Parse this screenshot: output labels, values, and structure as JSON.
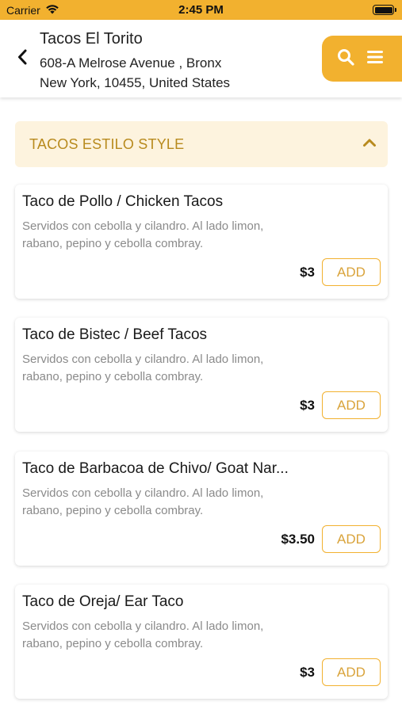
{
  "status_bar": {
    "carrier": "Carrier",
    "time": "2:45 PM"
  },
  "header": {
    "restaurant_name": "Tacos El Torito",
    "address_line1": "608-A Melrose Avenue , Bronx",
    "address_line2": "New York, 10455, United States"
  },
  "category": {
    "title": "TACOS ESTILO STYLE"
  },
  "items": [
    {
      "name": "Taco de Pollo / Chicken Tacos",
      "description": "Servidos con cebolla y cilandro. Al lado limon, rabano, pepino y cebolla combray.",
      "price": "$3",
      "add_label": "ADD"
    },
    {
      "name": "Taco de Bistec / Beef Tacos",
      "description": "Servidos con cebolla y cilandro. Al lado limon, rabano, pepino y cebolla combray.",
      "price": "$3",
      "add_label": "ADD"
    },
    {
      "name": "Taco de Barbacoa de Chivo/ Goat Nar...",
      "description": "Servidos con cebolla y cilandro. Al lado limon, rabano, pepino y cebolla combray.",
      "price": "$3.50",
      "add_label": "ADD"
    },
    {
      "name": "Taco de Oreja/ Ear Taco",
      "description": "Servidos con cebolla y cilandro. Al lado limon, rabano, pepino y cebolla combray.",
      "price": "$3",
      "add_label": "ADD"
    }
  ],
  "colors": {
    "accent": "#f2b12f",
    "category_bg": "#fdf3de",
    "category_text": "#b88a1d"
  },
  "icons": {
    "back": "chevron-left-icon",
    "search": "search-icon",
    "menu": "hamburger-menu-icon",
    "collapse": "chevron-up-icon",
    "wifi": "wifi-icon",
    "battery": "battery-icon"
  }
}
